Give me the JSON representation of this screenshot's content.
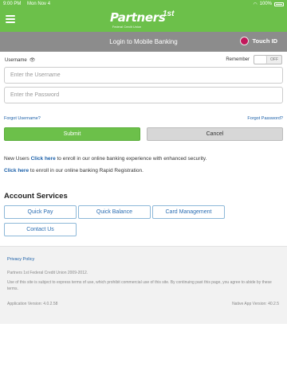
{
  "status": {
    "time": "9:00 PM",
    "date": "Mon Nov 4",
    "battery": "100%"
  },
  "header": {
    "logo_main": "Partners",
    "logo_sup": "1st",
    "logo_sub": "Federal Credit Union"
  },
  "login_bar": {
    "title": "Login to Mobile Banking",
    "touch_id": "Touch ID"
  },
  "form": {
    "username_label": "Username",
    "remember_label": "Remember",
    "remember_state": "OFF",
    "username_placeholder": "Enter the Username",
    "password_placeholder": "Enter the Password",
    "forgot_username": "Forgot Username?",
    "forgot_password": "Forgot Password?",
    "submit": "Submit",
    "cancel": "Cancel"
  },
  "enroll": {
    "line1_prefix": "New Users",
    "line1_link": "Click here",
    "line1_suffix": "to enroll in our online banking experience with enhanced security.",
    "line2_link": "Click here",
    "line2_suffix": "to enroll in our online banking Rapid Registration."
  },
  "services": {
    "title": "Account Services",
    "buttons": [
      "Quick Pay",
      "Quick Balance",
      "Card Management",
      "Contact Us"
    ]
  },
  "footer": {
    "privacy": "Privacy Policy",
    "copyright": "Partners 1st Federal Credit Union 2009-2012.",
    "terms": "Use of this site is subject to express terms of use, which prohibit commercial use of this site. By continuing past this page, you agree to abide by these terms.",
    "app_version": "Application Version: 4.0.2.58",
    "native_version": "Native App Version: 40.2.5"
  }
}
